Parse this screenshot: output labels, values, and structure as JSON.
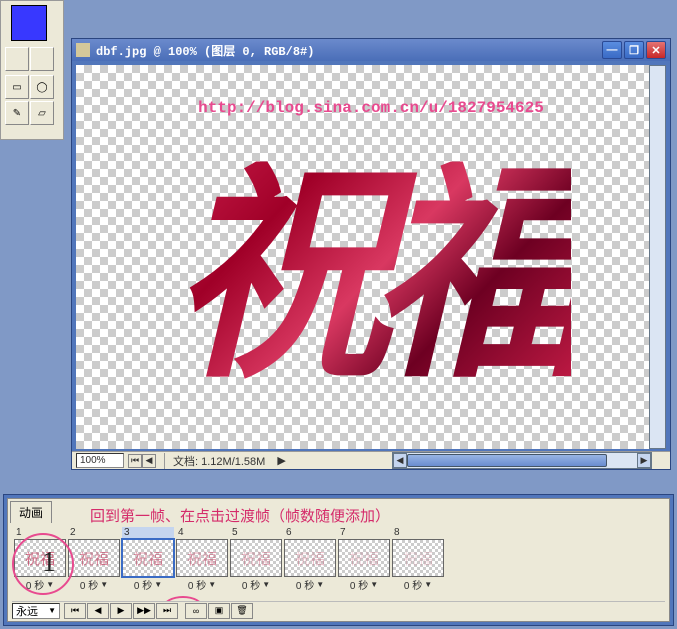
{
  "palette": {
    "foreground_color": "#3838ff"
  },
  "document": {
    "title": "dbf.jpg @ 100% (图层 0, RGB/8#)",
    "watermark_url": "http://blog.sina.com.cn/u/1827954625",
    "calligraphy_text": "祝福",
    "zoom": "100%",
    "doc_label": "文档:",
    "doc_size": "1.12M/1.58M"
  },
  "animation": {
    "tab_label": "动画",
    "annotation": "回到第一帧、在点击过渡帧（帧数随便添加）",
    "overlay_number": "1",
    "loop_mode": "永远",
    "frames": [
      {
        "num": "1",
        "delay": "0 秒",
        "selected": false,
        "opacity": 0.6
      },
      {
        "num": "2",
        "delay": "0 秒",
        "selected": false,
        "opacity": 0.5
      },
      {
        "num": "3",
        "delay": "0 秒",
        "selected": true,
        "opacity": 0.45
      },
      {
        "num": "4",
        "delay": "0 秒",
        "selected": false,
        "opacity": 0.4
      },
      {
        "num": "5",
        "delay": "0 秒",
        "selected": false,
        "opacity": 0.3
      },
      {
        "num": "6",
        "delay": "0 秒",
        "selected": false,
        "opacity": 0.25
      },
      {
        "num": "7",
        "delay": "0 秒",
        "selected": false,
        "opacity": 0.2
      },
      {
        "num": "8",
        "delay": "0 秒",
        "selected": false,
        "opacity": 0.15
      }
    ],
    "thumb_text": "祝福"
  }
}
